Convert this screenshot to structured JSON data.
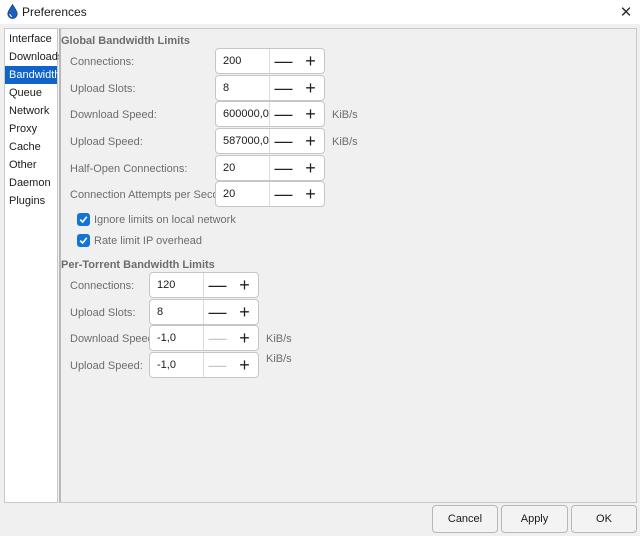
{
  "window": {
    "title": "Preferences",
    "app_icon": "drop-icon",
    "close_icon": "close-icon"
  },
  "sidebar": {
    "items": [
      {
        "label": "Interface"
      },
      {
        "label": "Downloads"
      },
      {
        "label": "Bandwidth",
        "selected": true
      },
      {
        "label": "Queue"
      },
      {
        "label": "Network"
      },
      {
        "label": "Proxy"
      },
      {
        "label": "Cache"
      },
      {
        "label": "Other"
      },
      {
        "label": "Daemon"
      },
      {
        "label": "Plugins"
      }
    ]
  },
  "global": {
    "title": "Global Bandwidth Limits",
    "connections": {
      "label": "Connections:",
      "value": "200"
    },
    "upload_slots": {
      "label": "Upload Slots:",
      "value": "8"
    },
    "download_speed": {
      "label": "Download Speed:",
      "value": "600000,0",
      "unit": "KiB/s"
    },
    "upload_speed": {
      "label": "Upload Speed:",
      "value": "587000,0",
      "unit": "KiB/s"
    },
    "half_open": {
      "label": "Half-Open Connections:",
      "value": "20"
    },
    "attempts": {
      "label": "Connection Attempts per Second:",
      "value": "20"
    },
    "ignore_local": {
      "label": "Ignore limits on local network",
      "checked": true
    },
    "rate_limit_ip": {
      "label": "Rate limit IP overhead",
      "checked": true
    }
  },
  "per_torrent": {
    "title": "Per-Torrent Bandwidth Limits",
    "connections": {
      "label": "Connections:",
      "value": "120"
    },
    "upload_slots": {
      "label": "Upload Slots:",
      "value": "8"
    },
    "download_speed": {
      "label": "Download Speed:",
      "value": "-1,0",
      "unit": "KiB/s"
    },
    "upload_speed": {
      "label": "Upload Speed:",
      "value": "-1,0",
      "unit": "KiB/s"
    }
  },
  "controls": {
    "minus": "—",
    "plus": "+"
  },
  "footer": {
    "cancel": "Cancel",
    "apply": "Apply",
    "ok": "OK"
  },
  "colors": {
    "accent": "#0f63c9",
    "checkbox": "#1473d6",
    "muted_text": "#6d6d6d"
  }
}
